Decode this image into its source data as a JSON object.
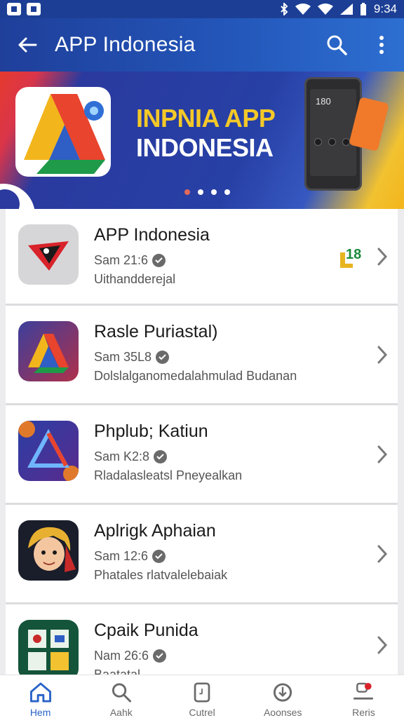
{
  "status_bar": {
    "time": "9:34"
  },
  "app_bar": {
    "title": "APP Indonesia"
  },
  "banner": {
    "headline_line1": "INPNIA APP",
    "headline_line2": "INDONESIA",
    "phone_time": "180",
    "page_dots": 4,
    "active_dot": 0
  },
  "apps": [
    {
      "name": "APP Indonesia",
      "meta": "Sam 21:6",
      "desc": "Uithandderejal",
      "badge": "18"
    },
    {
      "name": "Rasle Puriastal)",
      "meta": "Sam 35L8",
      "desc": "Dolslalganomedalahmulad Budanan"
    },
    {
      "name": "Phplub; Katiun",
      "meta": "Sam K2:8",
      "desc": "Rladalasleatsl Pneyealkan"
    },
    {
      "name": "Aplrigk Aphaian",
      "meta": "Sam 12:6",
      "desc": "Phatales rlatvalelebaiak"
    },
    {
      "name": "Cpaik Punida",
      "meta": "Nam 26:6",
      "desc": "Baatatal"
    }
  ],
  "bottom_nav": [
    {
      "label": "Hem",
      "icon": "home-icon"
    },
    {
      "label": "Aahk",
      "icon": "search-icon"
    },
    {
      "label": "Cutrel",
      "icon": "phone-icon"
    },
    {
      "label": "Aoonses",
      "icon": "download-icon"
    },
    {
      "label": "Reris",
      "icon": "updates-icon"
    }
  ],
  "colors": {
    "app_bar": "#2355b8",
    "accent": "#2a64c8",
    "banner_yellow": "#f4c928"
  }
}
